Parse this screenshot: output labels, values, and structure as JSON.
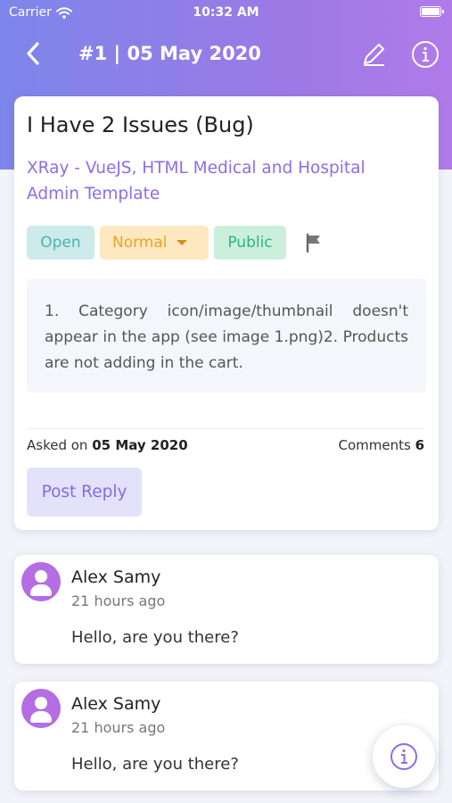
{
  "status_bar": {
    "carrier": "Carrier",
    "time": "10:32 AM"
  },
  "nav": {
    "title": "#1 | 05 May 2020",
    "icons": [
      "back-arrow-icon",
      "edit-pencil-icon",
      "info-icon"
    ]
  },
  "ticket": {
    "title": "I Have 2 Issues (Bug)",
    "project": "XRay - VueJS, HTML Medical and Hospital Admin Template",
    "tags": {
      "status": "Open",
      "priority": "Normal",
      "visibility": "Public"
    },
    "description": "1. Category icon/image/thumbnail doesn't appear in the app (see image 1.png)2. Products are not adding in the cart.",
    "asked_label": "Asked on",
    "asked_date": "05 May 2020",
    "comments_label": "Comments",
    "comments_count": "6",
    "reply_button": "Post Reply"
  },
  "comments": [
    {
      "author": "Alex Samy",
      "time": "21 hours ago",
      "text": "Hello, are you there?"
    },
    {
      "author": "Alex Samy",
      "time": "21 hours ago",
      "text": "Hello, are you there?"
    }
  ],
  "colors": {
    "accent": "#8e6cea",
    "header_gradient_start": "#7d86ea",
    "header_gradient_end": "#b07be9",
    "open": "#4bb3ad",
    "normal": "#f0a21c",
    "public": "#2fb57a",
    "avatar": "#b46de3"
  }
}
